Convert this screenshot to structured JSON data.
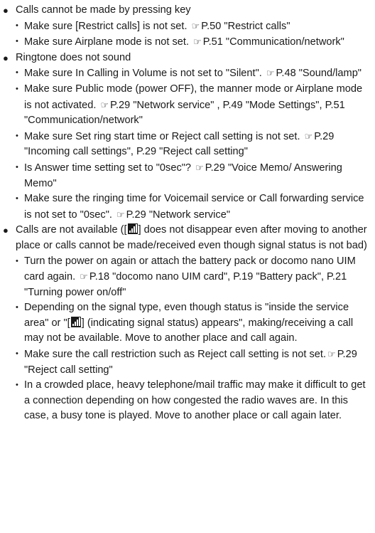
{
  "sections": [
    {
      "heading": "Calls cannot be made by pressing key",
      "items": [
        [
          "Make sure [Restrict calls] is not set. ",
          "ref",
          "P.50 \"Restrict calls\""
        ],
        [
          "Make sure Airplane mode is not set. ",
          "ref",
          "P.51 \"Communication/network\""
        ]
      ]
    },
    {
      "heading": "Ringtone does not sound",
      "items": [
        [
          "Make sure In Calling in Volume is not set to \"Silent\". ",
          "ref",
          "P.48 \"Sound/lamp\""
        ],
        [
          "Make sure Public mode (power OFF), the manner mode or Airplane mode is not activated. ",
          "ref",
          "P.29 \"Network service\" , P.49 \"Mode Settings\", P.51 \"Communication/network\""
        ],
        [
          "Make sure Set ring start time or Reject call setting is not set. ",
          "ref",
          "P.29 \"Incoming call settings\", P.29 \"Reject call setting\""
        ],
        [
          "Is Answer time setting set to \"0sec\"? ",
          "ref",
          "P.29 \"Voice Memo/ Answering Memo\""
        ],
        [
          "Make sure the ringing time for Voicemail service or Call forwarding service is not set to \"0sec\". ",
          "ref",
          "P.29 \"Network service\""
        ]
      ]
    },
    {
      "heading_parts": [
        "Calls are not available ([",
        "sig",
        "] does not disappear even after moving to another place or calls cannot be made/received even though signal status is not bad)"
      ],
      "items": [
        [
          "Turn the power on again or attach the battery pack or docomo nano UIM card again. ",
          "ref",
          "P.18 \"docomo nano UIM card\", P.19 \"Battery pack\", P.21 \"Turning power on/off\""
        ],
        [
          "Depending on the signal type, even though status is \"inside the service area\" or \"[",
          "sig",
          "] (indicating signal status) appears\", making/receiving a call may not be available. Move to another place and call again."
        ],
        [
          "Make sure the call restriction such as Reject call setting is not set.",
          "ref",
          "P.29 \"Reject call setting\""
        ],
        [
          "In a crowded place, heavy telephone/mail traffic may make it difficult to get a connection depending on how congested the radio waves are. In this case, a busy tone is played. Move to another place or call again later."
        ]
      ]
    }
  ],
  "glyphs": {
    "bullet": "●",
    "sub_bullet": "・",
    "ref_icon": "☞"
  },
  "icons": {
    "ref": "pointing-hand-reference-icon",
    "sig": "signal-strength-icon"
  }
}
